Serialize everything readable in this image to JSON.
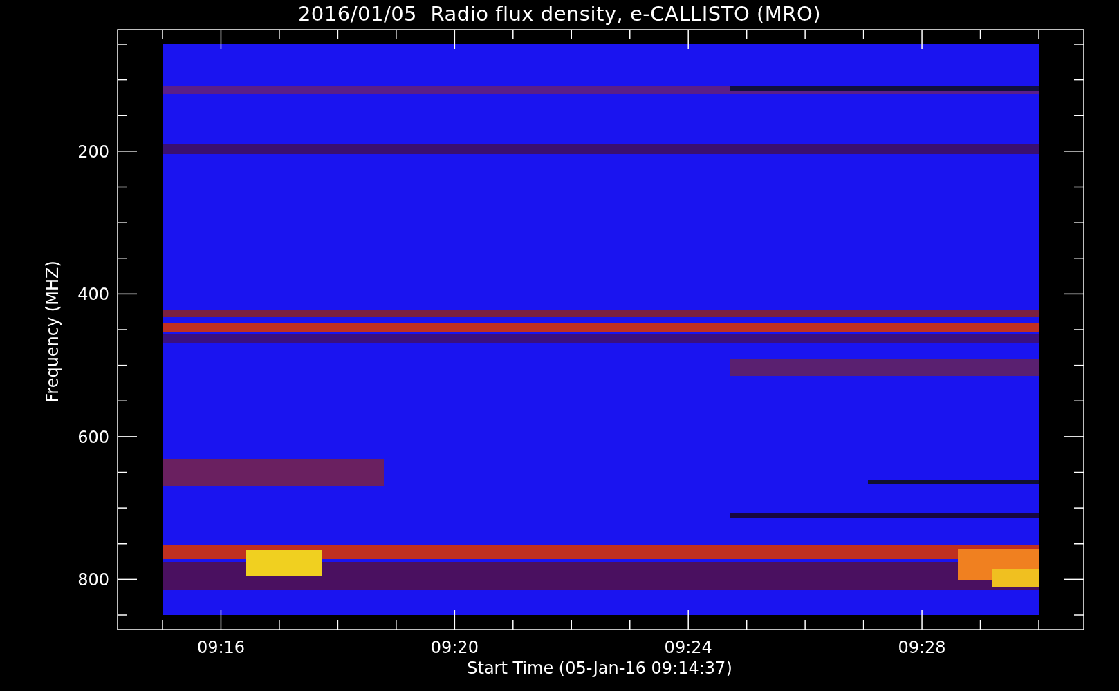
{
  "title": "2016/01/05  Radio flux density, e-CALLISTO (MRO)",
  "y_axis": {
    "label": "Frequency (MHZ)",
    "tick_labels": [
      "200",
      "400",
      "600",
      "800"
    ]
  },
  "x_axis": {
    "label": "Start Time (05-Jan-16 09:14:37)",
    "tick_labels": [
      "09:16",
      "09:20",
      "09:24",
      "09:28"
    ]
  }
}
